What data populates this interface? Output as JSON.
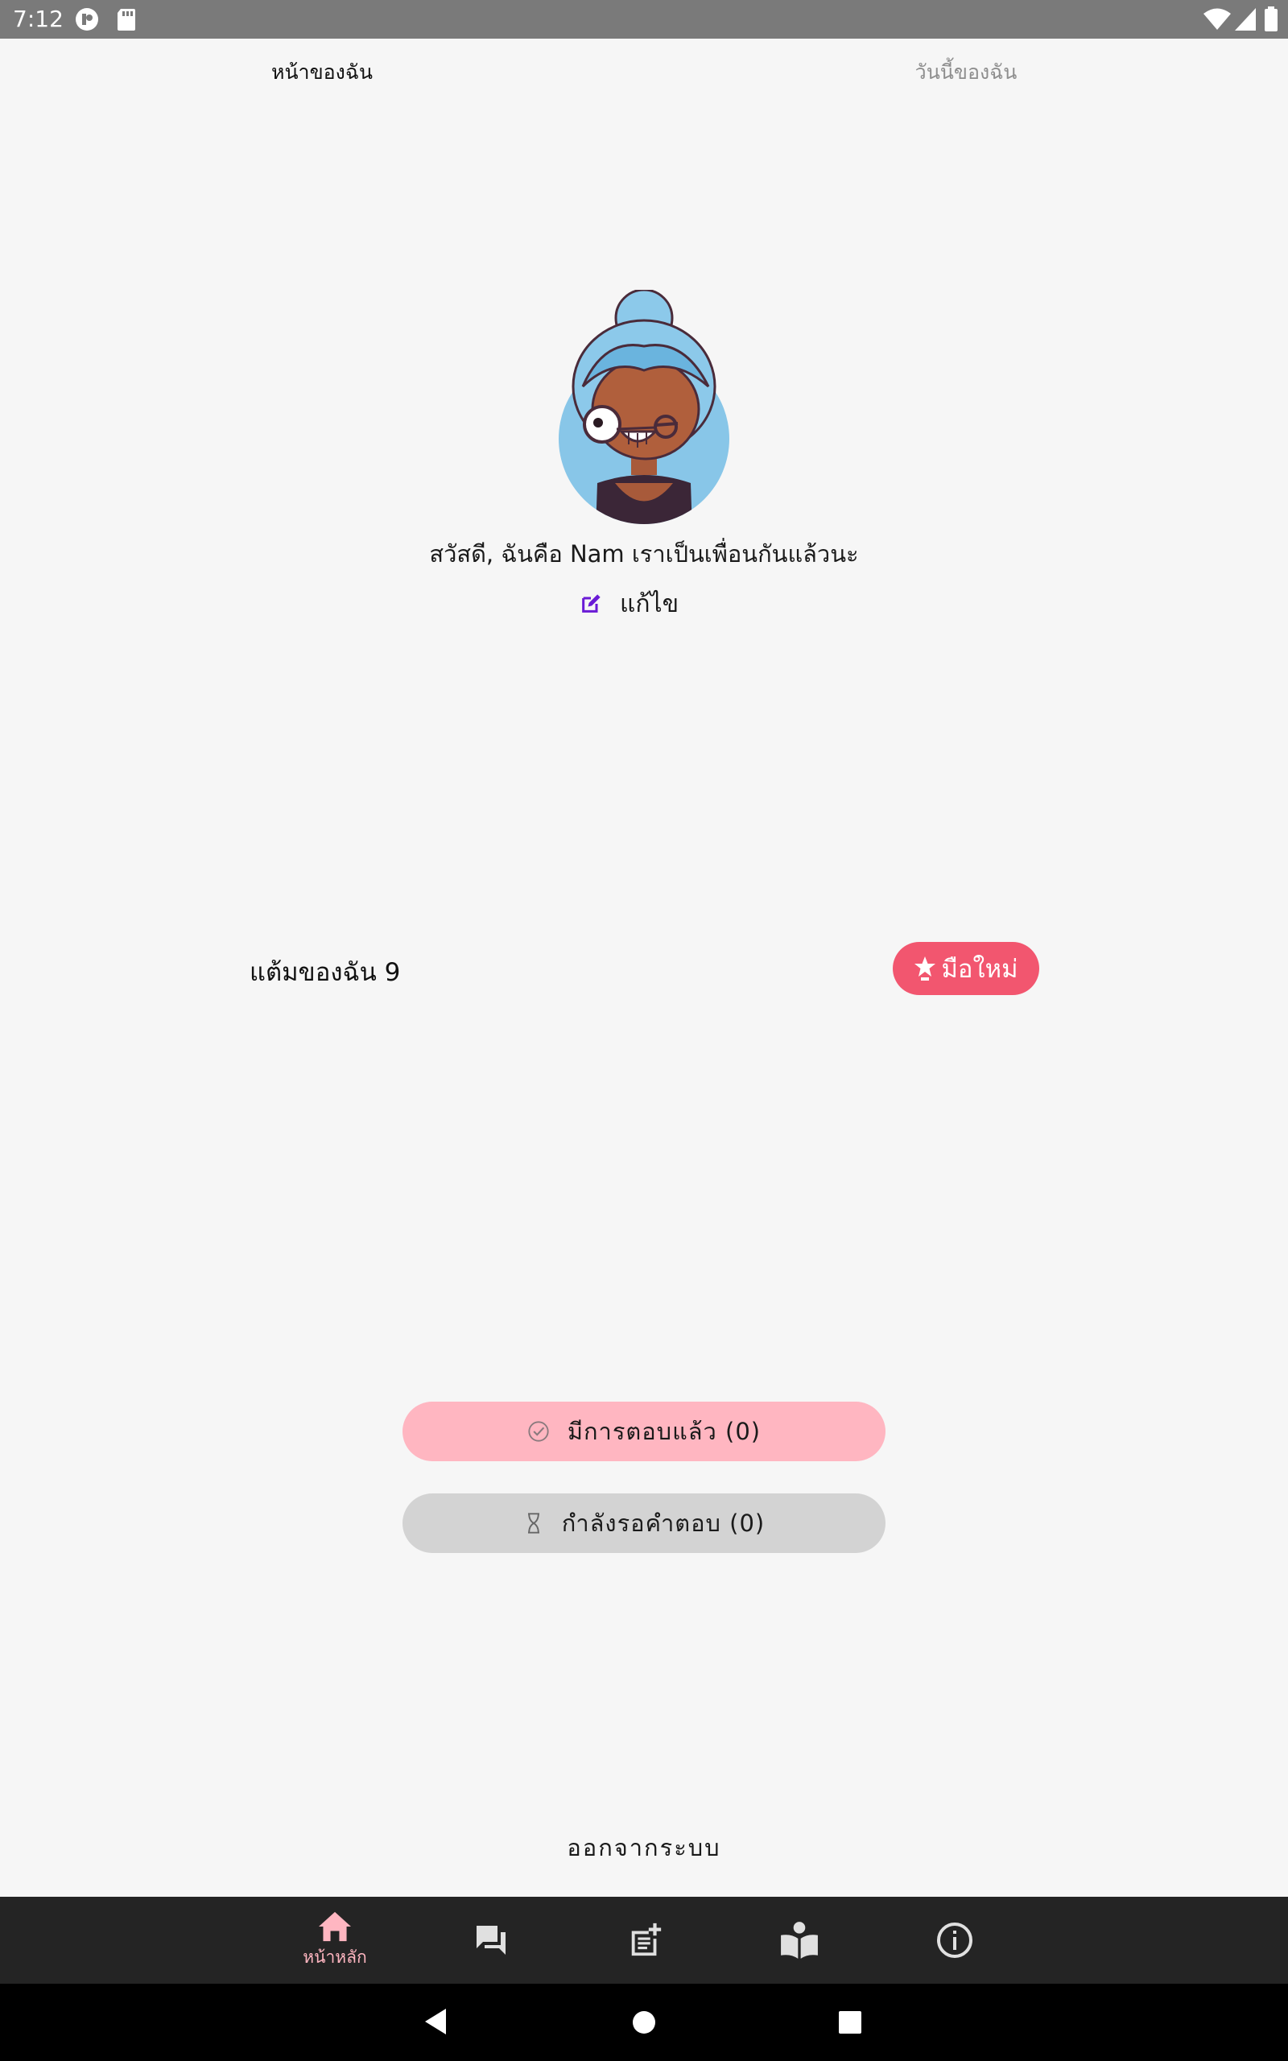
{
  "status_bar": {
    "time": "7:12",
    "icons": [
      "app-notification-icon",
      "sd-card-icon",
      "wifi-icon",
      "cell-signal-icon",
      "battery-icon"
    ]
  },
  "tabs": {
    "my_page": "หน้าของฉัน",
    "my_today": "วันนี้ของฉัน"
  },
  "profile": {
    "greeting": "สวัสดี, ฉันคือ Nam เราเป็นเพื่อนกันแล้วนะ",
    "edit_label": "แก้ไข"
  },
  "points": {
    "label": "แต้มของฉัน 9",
    "badge_label": "มือใหม่"
  },
  "actions": {
    "answered": "มีการตอบแล้ว (0)",
    "waiting": "กำลังรอคำตอบ (0)"
  },
  "logout_label": "ออกจากระบบ",
  "bottom_nav": {
    "home_label": "หน้าหลัก",
    "items": [
      "home-icon",
      "chat-icon",
      "new-post-icon",
      "read-icon",
      "info-icon"
    ]
  },
  "colors": {
    "accent": "#f2566f",
    "pink_light": "#ffb6c1",
    "nav_bg": "#242424",
    "edit_icon": "#6a1bd6"
  }
}
